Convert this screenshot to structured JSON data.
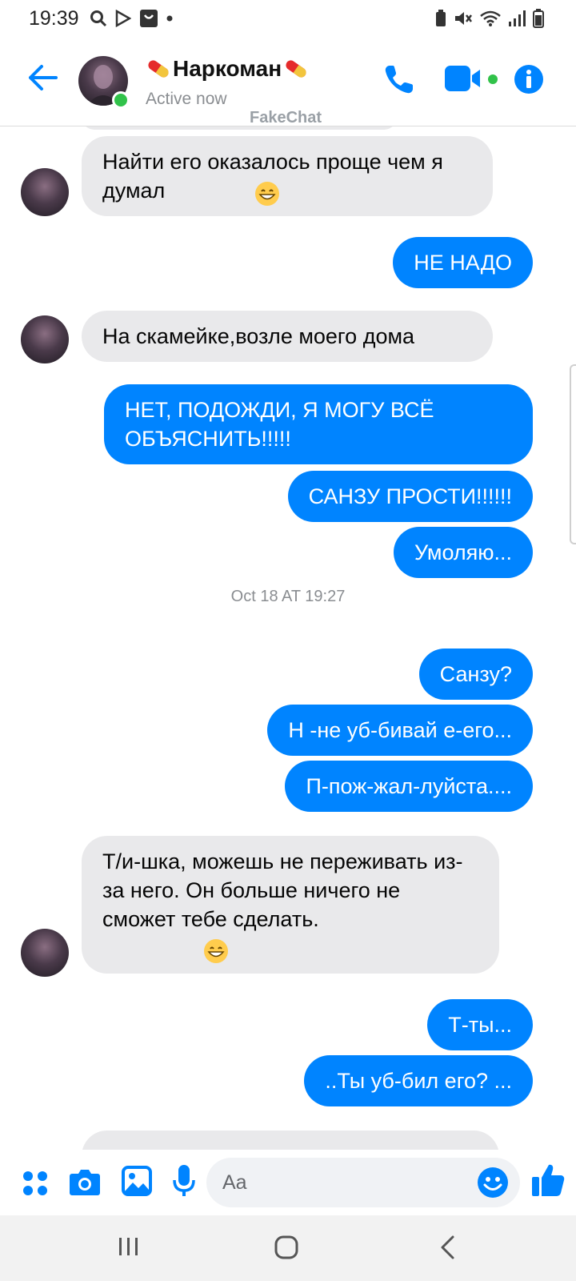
{
  "status_bar": {
    "time": "19:39"
  },
  "header": {
    "contact_name": "Наркоман",
    "status": "Active now",
    "watermark": "FakeChat"
  },
  "messages": {
    "m0": "Найти его оказалось проще чем я думал",
    "m1": "НЕ НАДО",
    "m2": "На  скамейке,возле моего дома",
    "m3": "НЕТ, ПОДОЖДИ, Я МОГУ ВСЁ ОБЪЯСНИТЬ!!!!!",
    "m4": "САНЗУ ПРОСТИ!!!!!!",
    "m5": "Умоляю...",
    "timestamp": "Oct 18 AT 19:27",
    "m6": "Санзу?",
    "m7": "Н -не уб-бивай е-его...",
    "m8": "П-пож-жал-луйста....",
    "m9": "Т/и-шка, можешь не переживать из-за него. Он больше ничего не сможет тебе сделать.",
    "m10": "Т-ты...",
    "m11": "..Ты уб-бил его? ..."
  },
  "composer": {
    "placeholder": "Aa"
  },
  "colors": {
    "accent": "#0084ff",
    "incoming_bubble": "#e9e9eb",
    "online": "#31c24a"
  },
  "icons": [
    "back-arrow-icon",
    "phone-icon",
    "video-camera-icon",
    "info-icon",
    "menu-dots-icon",
    "camera-icon",
    "gallery-icon",
    "microphone-icon",
    "emoji-icon",
    "thumbs-up-icon",
    "pill-emoji-icon",
    "grin-emoji-icon",
    "recents-icon",
    "home-icon",
    "back-nav-icon"
  ]
}
